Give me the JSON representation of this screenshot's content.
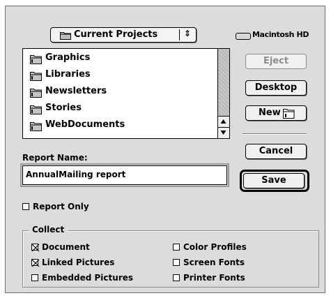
{
  "location_popup": {
    "label": "Current Projects",
    "arrows": "⇕"
  },
  "volume": {
    "label": "Macintosh HD"
  },
  "file_list": {
    "items": [
      {
        "label": "Graphics"
      },
      {
        "label": "Libraries"
      },
      {
        "label": "Newsletters"
      },
      {
        "label": "Stories"
      },
      {
        "label": "WebDocuments"
      }
    ]
  },
  "buttons": {
    "eject": "Eject",
    "desktop": "Desktop",
    "new": "New",
    "cancel": "Cancel",
    "save": "Save"
  },
  "report_name": {
    "label": "Report Name:",
    "value": "AnnualMailing report"
  },
  "report_only": {
    "label": "Report Only",
    "checked": false
  },
  "collect": {
    "title": "Collect",
    "left": [
      {
        "label": "Document",
        "checked": true
      },
      {
        "label": "Linked Pictures",
        "checked": true
      },
      {
        "label": "Embedded Pictures",
        "checked": false
      }
    ],
    "right": [
      {
        "label": "Color Profiles",
        "checked": false
      },
      {
        "label": "Screen Fonts",
        "checked": false
      },
      {
        "label": "Printer Fonts",
        "checked": false
      }
    ]
  }
}
